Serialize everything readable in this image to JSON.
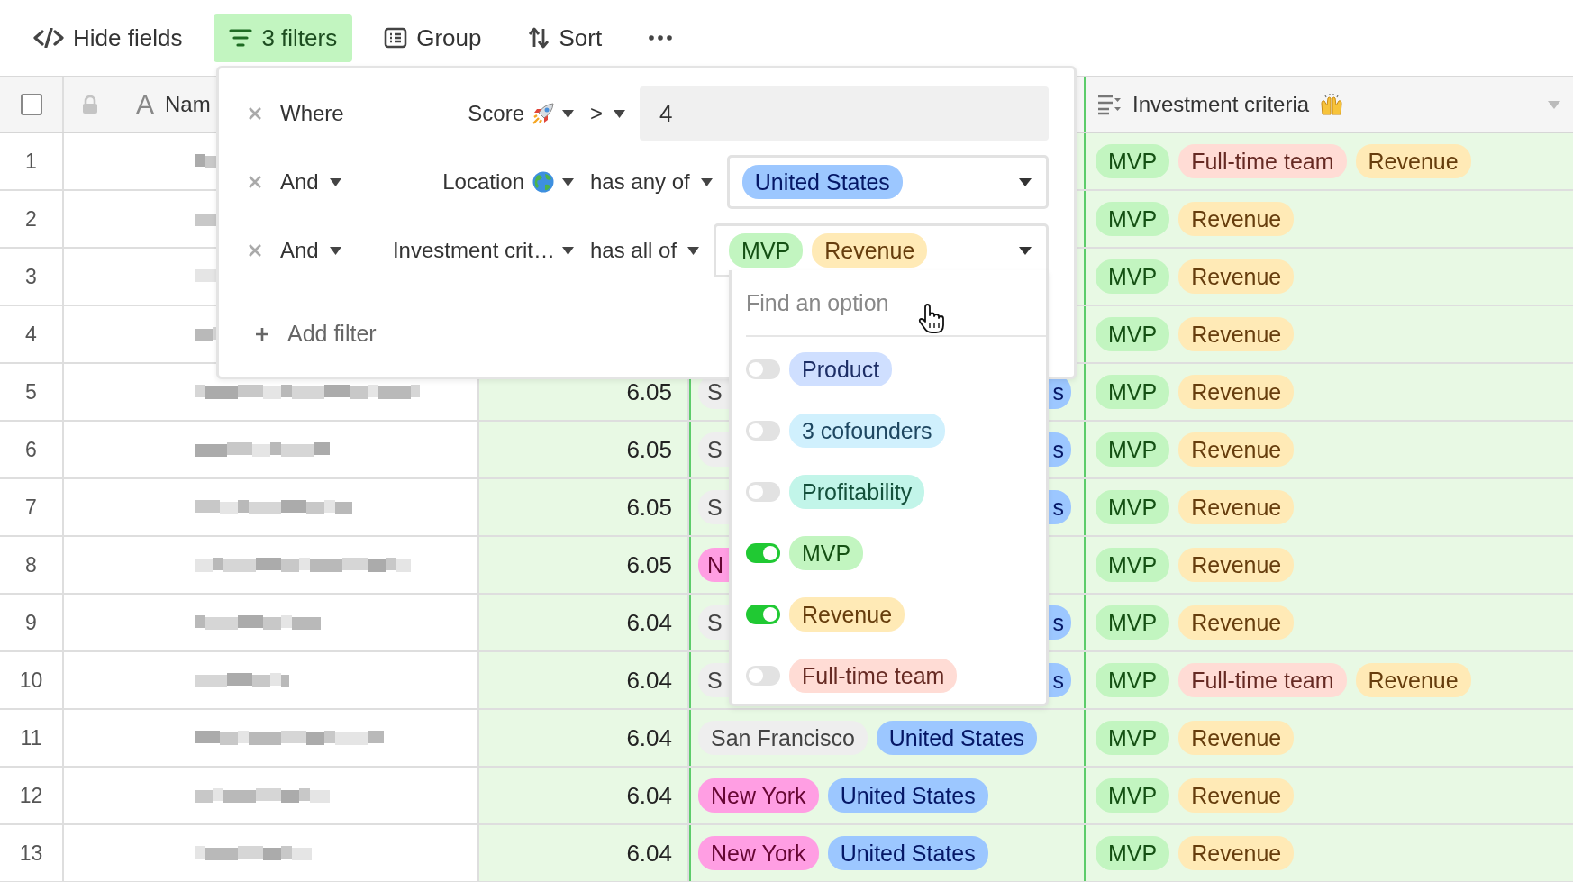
{
  "toolbar": [
    {
      "kind": "hide",
      "label": "Hide fields",
      "selected": false
    },
    {
      "kind": "filter",
      "label": "3 filters",
      "selected": true
    },
    {
      "kind": "group",
      "label": "Group",
      "selected": false
    },
    {
      "kind": "sort",
      "label": "Sort",
      "selected": false
    },
    {
      "kind": "more",
      "selected": false
    }
  ],
  "header": {
    "select_all_checked": false,
    "name_type": "A",
    "name_label": "Nam",
    "criteria_label": "Investment criteria"
  },
  "rows": [
    {
      "number": "1",
      "criteria": [
        {
          "text": "MVP",
          "color": "#c2f5c0"
        },
        {
          "text": "Full-time team",
          "color": "#ffdcd5"
        },
        {
          "text": "Revenue",
          "color": "#ffeab6"
        }
      ]
    },
    {
      "number": "2",
      "criteria": [
        {
          "text": "MVP",
          "color": "#c2f5c0"
        },
        {
          "text": "Revenue",
          "color": "#ffeab6"
        }
      ]
    },
    {
      "number": "3",
      "criteria": [
        {
          "text": "MVP",
          "color": "#c2f5c0"
        },
        {
          "text": "Revenue",
          "color": "#ffeab6"
        }
      ]
    },
    {
      "number": "4",
      "criteria": [
        {
          "text": "MVP",
          "color": "#c2f5c0"
        },
        {
          "text": "Revenue",
          "color": "#ffeab6"
        }
      ]
    },
    {
      "number": "5",
      "score": "6.05",
      "location": [
        {
          "text": "S",
          "color": "#eeeeee",
          "kind": "cut_end"
        },
        {
          "text": "s",
          "color": "#9cc7ff",
          "kind": "cut_start"
        }
      ],
      "criteria": [
        {
          "text": "MVP",
          "color": "#c2f5c0"
        },
        {
          "text": "Revenue",
          "color": "#ffeab6"
        }
      ]
    },
    {
      "number": "6",
      "score": "6.05",
      "location": [
        {
          "text": "S",
          "color": "#eeeeee",
          "kind": "cut_end"
        },
        {
          "text": "s",
          "color": "#9cc7ff",
          "kind": "cut_start"
        }
      ],
      "criteria": [
        {
          "text": "MVP",
          "color": "#c2f5c0"
        },
        {
          "text": "Revenue",
          "color": "#ffeab6"
        }
      ]
    },
    {
      "number": "7",
      "score": "6.05",
      "location": [
        {
          "text": "S",
          "color": "#eeeeee",
          "kind": "cut_end"
        },
        {
          "text": "s",
          "color": "#9cc7ff",
          "kind": "cut_start"
        }
      ],
      "criteria": [
        {
          "text": "MVP",
          "color": "#c2f5c0"
        },
        {
          "text": "Revenue",
          "color": "#ffeab6"
        }
      ]
    },
    {
      "number": "8",
      "score": "6.05",
      "location": [
        {
          "text": "N",
          "color": "#ff9ee3",
          "kind": "cut_end"
        }
      ],
      "criteria": [
        {
          "text": "MVP",
          "color": "#c2f5c0"
        },
        {
          "text": "Revenue",
          "color": "#ffeab6"
        }
      ]
    },
    {
      "number": "9",
      "score": "6.04",
      "location": [
        {
          "text": "S",
          "color": "#eeeeee",
          "kind": "cut_end"
        },
        {
          "text": "s",
          "color": "#9cc7ff",
          "kind": "cut_start"
        }
      ],
      "criteria": [
        {
          "text": "MVP",
          "color": "#c2f5c0"
        },
        {
          "text": "Revenue",
          "color": "#ffeab6"
        }
      ]
    },
    {
      "number": "10",
      "score": "6.04",
      "location": [
        {
          "text": "S",
          "color": "#eeeeee",
          "kind": "cut_end"
        },
        {
          "text": "s",
          "color": "#9cc7ff",
          "kind": "cut_start"
        }
      ],
      "criteria": [
        {
          "text": "MVP",
          "color": "#c2f5c0"
        },
        {
          "text": "Full-time team",
          "color": "#ffdcd5"
        },
        {
          "text": "Revenue",
          "color": "#ffeab6"
        }
      ]
    },
    {
      "number": "11",
      "score": "6.04",
      "location": [
        {
          "text": "San Francisco",
          "color": "#eeeeee"
        },
        {
          "text": "United States",
          "color": "#9cc7ff"
        }
      ],
      "criteria": [
        {
          "text": "MVP",
          "color": "#c2f5c0"
        },
        {
          "text": "Revenue",
          "color": "#ffeab6"
        }
      ]
    },
    {
      "number": "12",
      "score": "6.04",
      "location": [
        {
          "text": "New York",
          "color": "#ff9ee3"
        },
        {
          "text": "United States",
          "color": "#9cc7ff"
        }
      ],
      "criteria": [
        {
          "text": "MVP",
          "color": "#c2f5c0"
        },
        {
          "text": "Revenue",
          "color": "#ffeab6"
        }
      ]
    },
    {
      "number": "13",
      "score": "6.04",
      "location": [
        {
          "text": "New York",
          "color": "#ff9ee3"
        },
        {
          "text": "United States",
          "color": "#9cc7ff"
        }
      ],
      "criteria": [
        {
          "text": "MVP",
          "color": "#c2f5c0"
        },
        {
          "text": "Revenue",
          "color": "#ffeab6"
        }
      ]
    }
  ],
  "filters": {
    "conditions": [
      {
        "conjunction": "Where",
        "conjunction_menu": false,
        "field": {
          "text": "Score",
          "kind": "rocket"
        },
        "operator": ">",
        "kind": "text",
        "value": "4"
      },
      {
        "conjunction": "And",
        "conjunction_menu": true,
        "field": {
          "text": "Location",
          "kind": "globe"
        },
        "operator": "has any of",
        "kind": "tags",
        "open": false,
        "tags": [
          {
            "text": "United States",
            "color": "#9cc7ff"
          }
        ]
      },
      {
        "conjunction": "And",
        "conjunction_menu": true,
        "field": {
          "text": "Investment crit…"
        },
        "operator": "has all of",
        "kind": "tags",
        "open": true,
        "tags": [
          {
            "text": "MVP",
            "color": "#c2f5c0"
          },
          {
            "text": "Revenue",
            "color": "#ffeab6"
          }
        ]
      }
    ],
    "add_filter": "Add filter"
  },
  "dropdown": {
    "placeholder": "Find an option",
    "options": [
      {
        "text": "Product",
        "color": "#cfdfff",
        "on": false
      },
      {
        "text": "3 cofounders",
        "color": "#d0f0fd",
        "on": false
      },
      {
        "text": "Profitability",
        "color": "#c2f5e9",
        "on": false
      },
      {
        "text": "MVP",
        "color": "#c2f5c0",
        "on": true
      },
      {
        "text": "Revenue",
        "color": "#ffeab6",
        "on": true
      },
      {
        "text": "Full-time team",
        "color": "#ffdcd5",
        "on": false
      }
    ]
  }
}
